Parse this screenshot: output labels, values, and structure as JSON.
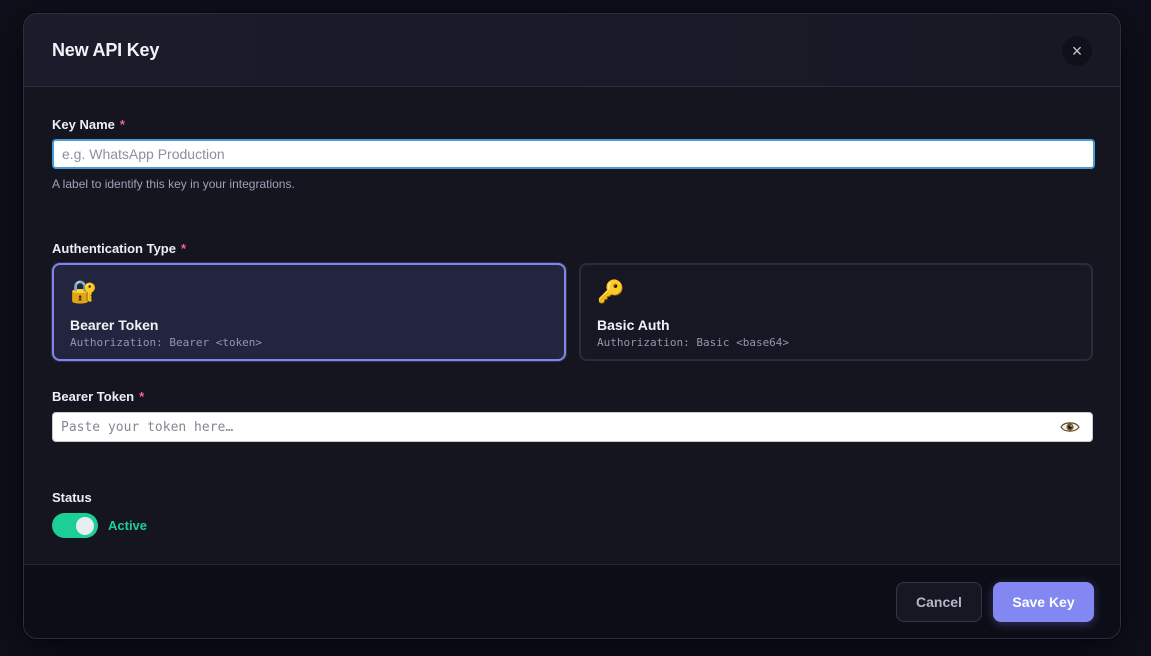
{
  "modal": {
    "title": "New API Key",
    "close_symbol": "×"
  },
  "fields": {
    "required_mark": "*",
    "key_name": {
      "label": "Key Name",
      "placeholder": "e.g. WhatsApp Production",
      "value": "",
      "hint": "A label to identify this key in your integrations."
    },
    "auth_type": {
      "label": "Authentication Type",
      "options": [
        {
          "icon": "🔐",
          "icon_name": "lock-with-key-icon",
          "title": "Bearer Token",
          "desc": "Authorization: Bearer <token>",
          "selected": true
        },
        {
          "icon": "🔑",
          "icon_name": "key-icon",
          "title": "Basic Auth",
          "desc": "Authorization: Basic <base64>",
          "selected": false
        }
      ]
    },
    "bearer_token": {
      "label": "Bearer Token",
      "placeholder": "Paste your token here…",
      "value": "",
      "reveal_icon": "eye-icon"
    },
    "status": {
      "label": "Status",
      "state_text": "Active",
      "enabled": true
    }
  },
  "footer": {
    "cancel_label": "Cancel",
    "save_label": "Save Key"
  },
  "colors": {
    "accent": "#8287f2",
    "active": "#1ccf97",
    "required": "#f0609a"
  }
}
